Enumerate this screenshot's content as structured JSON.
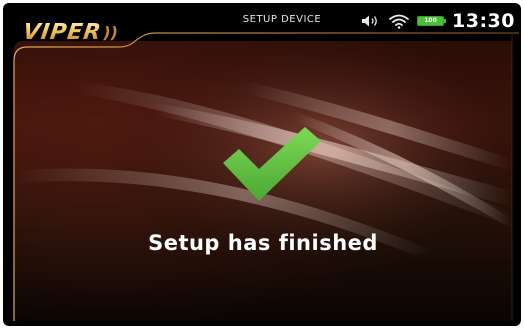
{
  "header": {
    "brand": "VIPER",
    "title": "SETUP DEVICE",
    "battery_level": "100",
    "time": "13:30"
  },
  "status_icons": [
    "speaker-icon",
    "wifi-icon",
    "battery-icon"
  ],
  "main": {
    "message": "Setup has finished",
    "icon": "checkmark-icon"
  },
  "colors": {
    "accent_gold": "#c58a2c",
    "success_green": "#5fc43f",
    "battery_green": "#46c233",
    "background": "#000000"
  }
}
